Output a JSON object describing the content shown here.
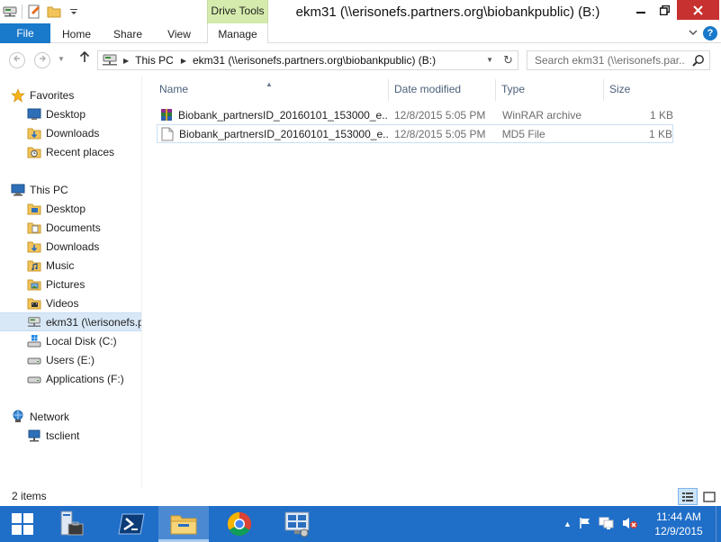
{
  "window": {
    "title": "ekm31 (\\\\erisonefs.partners.org\\biobankpublic) (B:)",
    "context_group": "Drive Tools"
  },
  "ribbon": {
    "tabs": [
      "File",
      "Home",
      "Share",
      "View",
      "Manage"
    ]
  },
  "address": {
    "crumbs": [
      "This PC",
      "ekm31 (\\\\erisonefs.partners.org\\biobankpublic) (B:)"
    ]
  },
  "search": {
    "placeholder": "Search ekm31 (\\\\erisonefs.par..."
  },
  "nav": {
    "favorites": {
      "label": "Favorites",
      "items": [
        "Desktop",
        "Downloads",
        "Recent places"
      ]
    },
    "this_pc": {
      "label": "This PC",
      "items": [
        "Desktop",
        "Documents",
        "Downloads",
        "Music",
        "Pictures",
        "Videos",
        "ekm31 (\\\\erisonefs.p",
        "Local Disk (C:)",
        "Users (E:)",
        "Applications (F:)"
      ]
    },
    "network": {
      "label": "Network",
      "items": [
        "tsclient"
      ]
    }
  },
  "columns": {
    "name": "Name",
    "date": "Date modified",
    "type": "Type",
    "size": "Size"
  },
  "files": [
    {
      "name": "Biobank_partnersID_20160101_153000_e...",
      "date": "12/8/2015 5:05 PM",
      "type": "WinRAR archive",
      "size": "1 KB",
      "icon": "winrar-archive-icon"
    },
    {
      "name": "Biobank_partnersID_20160101_153000_e...",
      "date": "12/8/2015 5:05 PM",
      "type": "MD5 File",
      "size": "1 KB",
      "icon": "generic-file-icon"
    }
  ],
  "status": {
    "count": "2 items"
  },
  "clock": {
    "time": "11:44 AM",
    "date": "12/9/2015"
  },
  "colors": {
    "accent": "#1979ca",
    "taskbar": "#1f6ec8",
    "context_tab": "#d5ebad",
    "close_button": "#c7312f",
    "selection": "#d9e8f7"
  }
}
